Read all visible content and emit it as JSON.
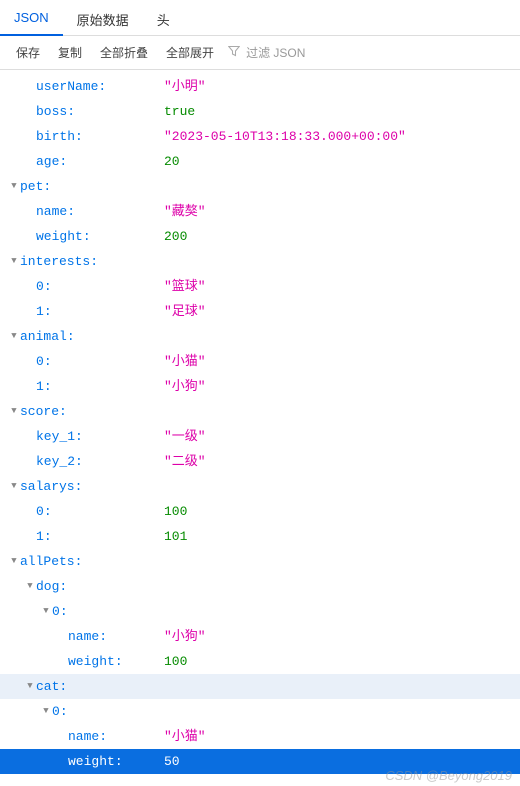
{
  "tabs": {
    "json": "JSON",
    "raw": "原始数据",
    "headers": "头"
  },
  "toolbar": {
    "save": "保存",
    "copy": "复制",
    "collapse": "全部折叠",
    "expand": "全部展开",
    "filter": "过滤 JSON"
  },
  "rows": [
    {
      "indent": 1,
      "tw": "",
      "key": "userName",
      "valType": "str",
      "val": "\"小明\""
    },
    {
      "indent": 1,
      "tw": "",
      "key": "boss",
      "valType": "bool",
      "val": "true"
    },
    {
      "indent": 1,
      "tw": "",
      "key": "birth",
      "valType": "str",
      "val": "\"2023-05-10T13:18:33.000+00:00\""
    },
    {
      "indent": 1,
      "tw": "",
      "key": "age",
      "valType": "num",
      "val": "20"
    },
    {
      "indent": 0,
      "tw": "▼",
      "key": "pet",
      "valType": "",
      "val": ""
    },
    {
      "indent": 1,
      "tw": "",
      "key": "name",
      "valType": "str",
      "val": "\"藏獒\""
    },
    {
      "indent": 1,
      "tw": "",
      "key": "weight",
      "valType": "num",
      "val": "200"
    },
    {
      "indent": 0,
      "tw": "▼",
      "key": "interests",
      "valType": "",
      "val": ""
    },
    {
      "indent": 1,
      "tw": "",
      "key": "0",
      "valType": "str",
      "val": "\"篮球\""
    },
    {
      "indent": 1,
      "tw": "",
      "key": "1",
      "valType": "str",
      "val": "\"足球\""
    },
    {
      "indent": 0,
      "tw": "▼",
      "key": "animal",
      "valType": "",
      "val": ""
    },
    {
      "indent": 1,
      "tw": "",
      "key": "0",
      "valType": "str",
      "val": "\"小猫\""
    },
    {
      "indent": 1,
      "tw": "",
      "key": "1",
      "valType": "str",
      "val": "\"小狗\""
    },
    {
      "indent": 0,
      "tw": "▼",
      "key": "score",
      "valType": "",
      "val": ""
    },
    {
      "indent": 1,
      "tw": "",
      "key": "key_1",
      "valType": "str",
      "val": "\"一级\""
    },
    {
      "indent": 1,
      "tw": "",
      "key": "key_2",
      "valType": "str",
      "val": "\"二级\""
    },
    {
      "indent": 0,
      "tw": "▼",
      "key": "salarys",
      "valType": "",
      "val": ""
    },
    {
      "indent": 1,
      "tw": "",
      "key": "0",
      "valType": "num",
      "val": "100"
    },
    {
      "indent": 1,
      "tw": "",
      "key": "1",
      "valType": "num",
      "val": "101"
    },
    {
      "indent": 0,
      "tw": "▼",
      "key": "allPets",
      "valType": "",
      "val": ""
    },
    {
      "indent": 1,
      "tw": "▼",
      "key": "dog",
      "valType": "",
      "val": ""
    },
    {
      "indent": 2,
      "tw": "▼",
      "key": "0",
      "valType": "",
      "val": ""
    },
    {
      "indent": 3,
      "tw": "",
      "key": "name",
      "valType": "str",
      "val": "\"小狗\""
    },
    {
      "indent": 3,
      "tw": "",
      "key": "weight",
      "valType": "num",
      "val": "100"
    },
    {
      "indent": 1,
      "tw": "▼",
      "key": "cat",
      "valType": "",
      "val": "",
      "hovered": true
    },
    {
      "indent": 2,
      "tw": "▼",
      "key": "0",
      "valType": "",
      "val": ""
    },
    {
      "indent": 3,
      "tw": "",
      "key": "name",
      "valType": "str",
      "val": "\"小猫\""
    },
    {
      "indent": 3,
      "tw": "",
      "key": "weight",
      "valType": "num",
      "val": "50",
      "selected": true
    }
  ],
  "watermark": "CSDN @Beyong2019"
}
